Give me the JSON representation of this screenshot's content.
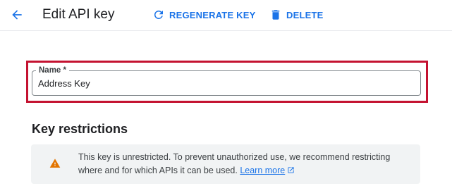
{
  "header": {
    "title": "Edit API key",
    "regenerate_label": "REGENERATE KEY",
    "delete_label": "DELETE"
  },
  "name_field": {
    "label": "Name *",
    "value": "Address Key"
  },
  "restrictions": {
    "heading": "Key restrictions",
    "banner_line1": "This key is unrestricted. To prevent unauthorized use, we recommend restricting",
    "banner_line2": "where and for which APIs it can be used.",
    "learn_more": "Learn more"
  },
  "colors": {
    "accent": "#1a73e8",
    "highlight": "#c41230",
    "warning": "#e37400",
    "banner_bg": "#f1f3f4"
  },
  "icons": {
    "back": "arrow-back-icon",
    "regenerate": "refresh-icon",
    "delete": "trash-icon",
    "warning": "warning-icon",
    "external": "open-in-new-icon"
  }
}
